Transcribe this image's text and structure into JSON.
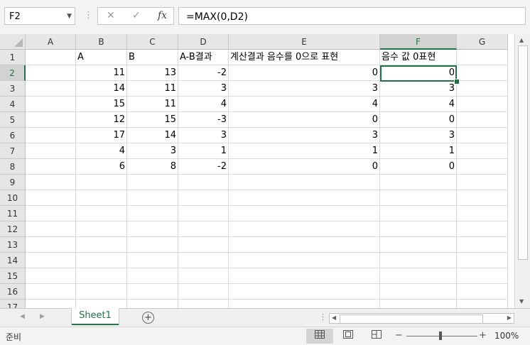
{
  "formula_bar": {
    "name_box": "F2",
    "cancel_icon": "✕",
    "enter_icon": "✓",
    "fx_icon": "fx",
    "formula": "=MAX(0,D2)"
  },
  "columns": [
    "A",
    "B",
    "C",
    "D",
    "E",
    "F",
    "G"
  ],
  "selected_column": "F",
  "selected_row": "2",
  "rows": [
    {
      "num": "1",
      "cells": [
        "",
        "A",
        "B",
        "A-B결과",
        "계산결과 음수를 0으로 표현",
        "음수 값 0표현",
        ""
      ]
    },
    {
      "num": "2",
      "cells": [
        "",
        "11",
        "13",
        "-2",
        "0",
        "0",
        ""
      ]
    },
    {
      "num": "3",
      "cells": [
        "",
        "14",
        "11",
        "3",
        "3",
        "3",
        ""
      ]
    },
    {
      "num": "4",
      "cells": [
        "",
        "15",
        "11",
        "4",
        "4",
        "4",
        ""
      ]
    },
    {
      "num": "5",
      "cells": [
        "",
        "12",
        "15",
        "-3",
        "0",
        "0",
        ""
      ]
    },
    {
      "num": "6",
      "cells": [
        "",
        "17",
        "14",
        "3",
        "3",
        "3",
        ""
      ]
    },
    {
      "num": "7",
      "cells": [
        "",
        "4",
        "3",
        "1",
        "1",
        "1",
        ""
      ]
    },
    {
      "num": "8",
      "cells": [
        "",
        "6",
        "8",
        "-2",
        "0",
        "0",
        ""
      ]
    },
    {
      "num": "9",
      "cells": [
        "",
        "",
        "",
        "",
        "",
        "",
        ""
      ]
    },
    {
      "num": "10",
      "cells": [
        "",
        "",
        "",
        "",
        "",
        "",
        ""
      ]
    },
    {
      "num": "11",
      "cells": [
        "",
        "",
        "",
        "",
        "",
        "",
        ""
      ]
    },
    {
      "num": "12",
      "cells": [
        "",
        "",
        "",
        "",
        "",
        "",
        ""
      ]
    },
    {
      "num": "13",
      "cells": [
        "",
        "",
        "",
        "",
        "",
        "",
        ""
      ]
    },
    {
      "num": "14",
      "cells": [
        "",
        "",
        "",
        "",
        "",
        "",
        ""
      ]
    },
    {
      "num": "15",
      "cells": [
        "",
        "",
        "",
        "",
        "",
        "",
        ""
      ]
    },
    {
      "num": "16",
      "cells": [
        "",
        "",
        "",
        "",
        "",
        "",
        ""
      ]
    },
    {
      "num": "17",
      "cells": [
        "",
        "",
        "",
        "",
        "",
        "",
        ""
      ]
    }
  ],
  "sheet_tabs": [
    "Sheet1"
  ],
  "add_sheet": "+",
  "status": {
    "mode": "준비",
    "zoom_minus": "−",
    "zoom_plus": "+",
    "zoom": "100%"
  }
}
